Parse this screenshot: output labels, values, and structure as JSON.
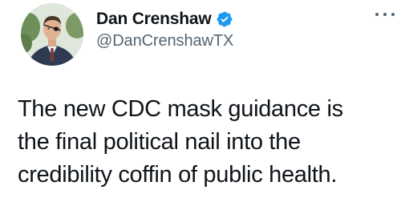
{
  "author": {
    "display_name": "Dan Crenshaw",
    "handle": "@DanCrenshawTX",
    "verified": true,
    "verified_color": "#1d9bf0",
    "avatar_icon": "profile-photo"
  },
  "menu": {
    "icon": "more-options-icon"
  },
  "tweet": {
    "lines": [
      "The new CDC mask guidance is",
      "the final political nail into the",
      "credibility coffin of public health."
    ]
  },
  "colors": {
    "text": "#0f1419",
    "secondary_text": "#536471",
    "background": "#ffffff"
  }
}
